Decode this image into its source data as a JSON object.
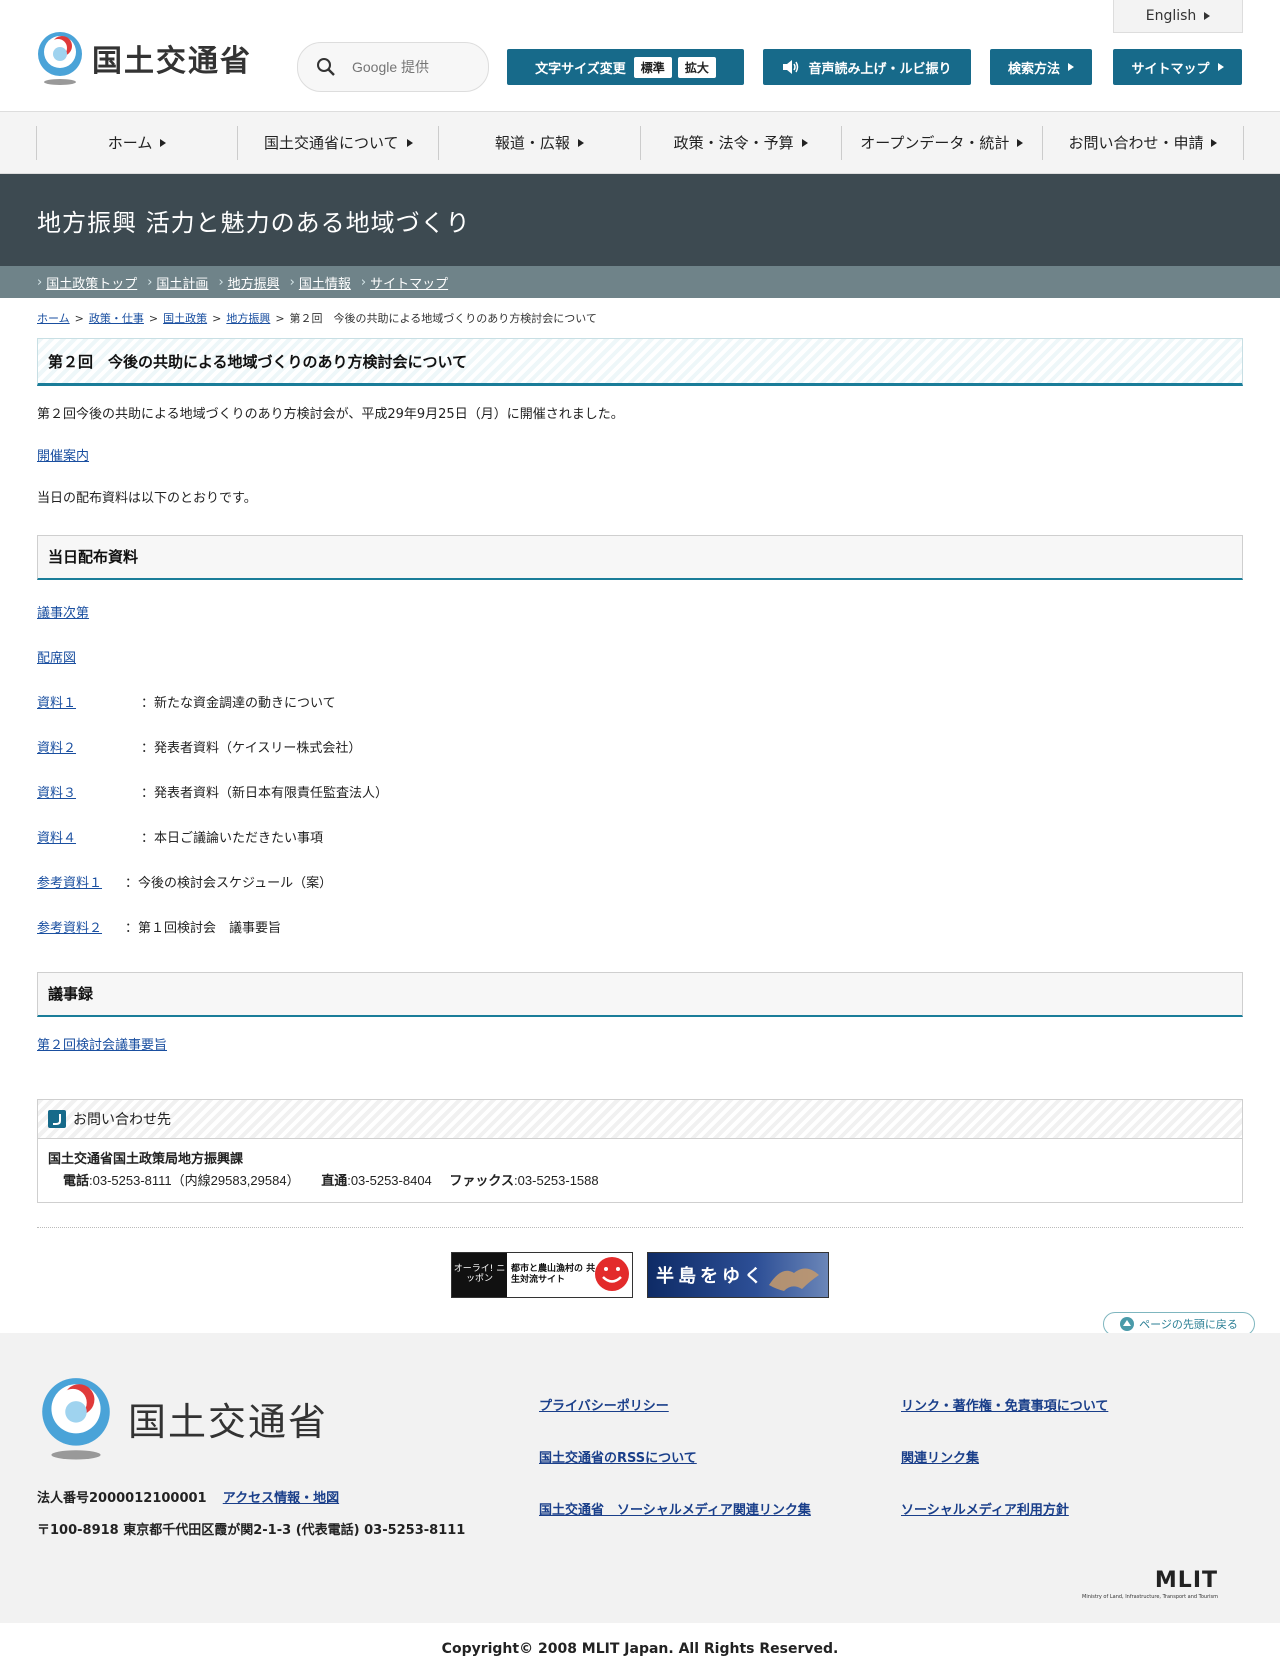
{
  "header": {
    "logo_text": "国土交通省",
    "search_placeholder": "Google 提供",
    "english": "English",
    "font_size_label": "文字サイズ変更",
    "size_standard": "標準",
    "size_large": "拡大",
    "read_aloud": "音声読み上げ・ルビ振り",
    "search_method": "検索方法",
    "sitemap": "サイトマップ"
  },
  "nav": [
    "ホーム",
    "国土交通省について",
    "報道・広報",
    "政策・法令・予算",
    "オープンデータ・統計",
    "お問い合わせ・申請"
  ],
  "band_title": "地方振興 活力と魅力のある地域づくり",
  "subnav": [
    "国土政策トップ",
    "国土計画",
    "地方振興",
    "国土情報",
    "サイトマップ"
  ],
  "breadcrumb": {
    "items": [
      "ホーム",
      "政策・仕事",
      "国土政策",
      "地方振興"
    ],
    "current": "第２回　今後の共助による地域づくりのあり方検討会について"
  },
  "page_title": "第２回　今後の共助による地域づくりのあり方検討会について",
  "intro": "第２回今後の共助による地域づくりのあり方検討会が、平成29年9月25日（月）に開催されました。",
  "guide_link": "開催案内",
  "materials_intro": "当日の配布資料は以下のとおりです。",
  "materials_heading": "当日配布資料",
  "materials": [
    {
      "label": "議事次第",
      "desc": ""
    },
    {
      "label": "配席図",
      "desc": ""
    },
    {
      "label": "資料１",
      "desc": "：新たな資金調達の動きについて"
    },
    {
      "label": "資料２",
      "desc": "：発表者資料（ケイスリー株式会社）"
    },
    {
      "label": "資料３",
      "desc": "：発表者資料（新日本有限責任監査法人）"
    },
    {
      "label": "資料４",
      "desc": "：本日ご議論いただきたい事項"
    },
    {
      "label": "参考資料１",
      "desc": "：今後の検討会スケジュール（案）"
    },
    {
      "label": "参考資料２",
      "desc": "：第１回検討会　議事要旨"
    }
  ],
  "minutes_heading": "議事録",
  "minutes_link": "第２回検討会議事要旨",
  "contact": {
    "heading": "お問い合わせ先",
    "org": "国土交通省国土政策局地方振興課",
    "tel_label": "電話",
    "tel": ":03-5253-8111（内線29583,29584）",
    "direct_label": "直通",
    "direct": ":03-5253-8404",
    "fax_label": "ファックス",
    "fax": ":03-5253-1588"
  },
  "banners": {
    "b1_left": "オーライ! ニッポン",
    "b1_right": "都市と農山漁村の 共生対流サイト",
    "b2": "半島をゆく"
  },
  "to_top": "ページの先頭に戻る",
  "footer": {
    "logo_text": "国土交通省",
    "corp_no": "法人番号2000012100001",
    "access": "アクセス情報・地図",
    "address": "〒100-8918 東京都千代田区霞が関2-1-3 (代表電話) 03-5253-8111",
    "links": [
      "プライバシーポリシー",
      "リンク・著作権・免責事項について",
      "国土交通省のRSSについて",
      "関連リンク集",
      "国土交通省　ソーシャルメディア関連リンク集",
      "ソーシャルメディア利用方針"
    ],
    "mlit": "MLIT",
    "mlit_sub": "Ministry of Land, Infrastructure, Transport and Tourism"
  },
  "copyright": "Copyright© 2008 MLIT Japan. All Rights Reserved.",
  "colors": {
    "accent": "#176a8a",
    "band": "#3d4a51",
    "subnav": "#6f8389",
    "link": "#1a4fa0"
  }
}
